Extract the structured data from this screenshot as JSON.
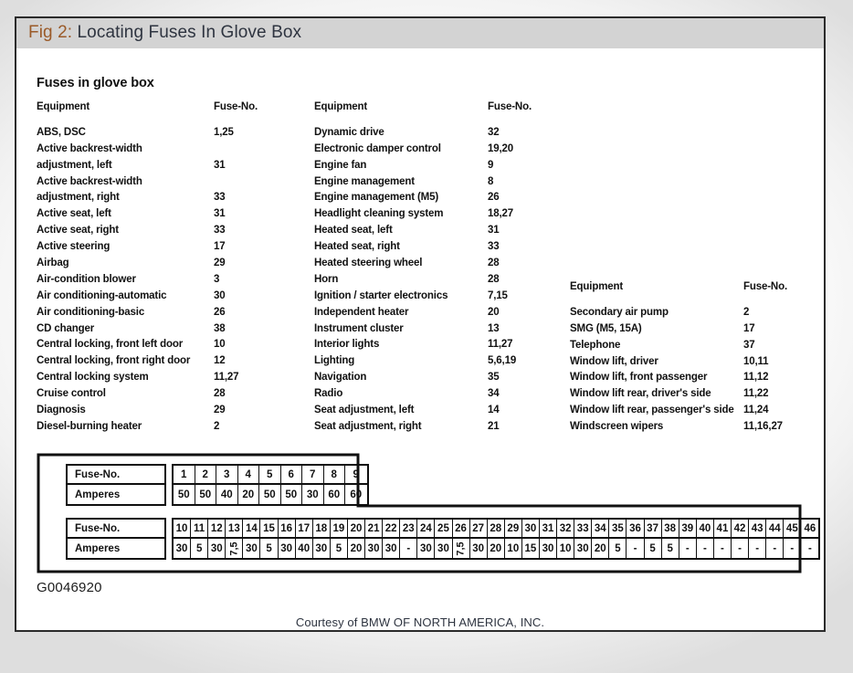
{
  "figure": {
    "title_prefix": "Fig 2:",
    "title_rest": " Locating Fuses In Glove Box",
    "heading": "Fuses in glove box",
    "graphic_id": "G0046920",
    "courtesy": "Courtesy of BMW OF NORTH AMERICA, INC.",
    "title_accent_color": "#9a5a28",
    "titlebar_color": "#d3d3d3"
  },
  "columns": {
    "header": {
      "equipment": "Equipment",
      "fuse_no": "Fuse-No."
    },
    "col1": [
      {
        "name": "ABS, DSC",
        "fuse": "1,25"
      },
      {
        "name": "Active backrest-width",
        "fuse": ""
      },
      {
        "name": "adjustment, left",
        "fuse": "31"
      },
      {
        "name": "Active backrest-width",
        "fuse": ""
      },
      {
        "name": "adjustment, right",
        "fuse": "33"
      },
      {
        "name": "Active seat, left",
        "fuse": "31"
      },
      {
        "name": "Active seat, right",
        "fuse": "33"
      },
      {
        "name": "Active steering",
        "fuse": "17"
      },
      {
        "name": "Airbag",
        "fuse": "29"
      },
      {
        "name": "Air-condition blower",
        "fuse": "3"
      },
      {
        "name": "Air conditioning-automatic",
        "fuse": "30"
      },
      {
        "name": "Air conditioning-basic",
        "fuse": "26"
      },
      {
        "name": "CD changer",
        "fuse": "38"
      },
      {
        "name": "Central locking, front left door",
        "fuse": "10"
      },
      {
        "name": "Central locking, front right door",
        "fuse": "12"
      },
      {
        "name": "Central locking system",
        "fuse": "11,27"
      },
      {
        "name": "Cruise control",
        "fuse": "28"
      },
      {
        "name": "Diagnosis",
        "fuse": "29"
      },
      {
        "name": "Diesel-burning heater",
        "fuse": "2"
      }
    ],
    "col2": [
      {
        "name": "Dynamic drive",
        "fuse": "32"
      },
      {
        "name": "Electronic damper control",
        "fuse": "19,20"
      },
      {
        "name": "Engine fan",
        "fuse": "9"
      },
      {
        "name": "Engine management",
        "fuse": "8"
      },
      {
        "name": "Engine management (M5)",
        "fuse": "26"
      },
      {
        "name": "Headlight cleaning system",
        "fuse": "18,27"
      },
      {
        "name": "Heated seat, left",
        "fuse": "31"
      },
      {
        "name": "Heated seat, right",
        "fuse": "33"
      },
      {
        "name": "Heated steering wheel",
        "fuse": "28"
      },
      {
        "name": "Horn",
        "fuse": "28"
      },
      {
        "name": "Ignition / starter electronics",
        "fuse": "7,15"
      },
      {
        "name": "Independent heater",
        "fuse": "20"
      },
      {
        "name": "Instrument cluster",
        "fuse": "13"
      },
      {
        "name": "Interior lights",
        "fuse": "11,27"
      },
      {
        "name": "Lighting",
        "fuse": "5,6,19"
      },
      {
        "name": "Navigation",
        "fuse": "35"
      },
      {
        "name": "Radio",
        "fuse": "34"
      },
      {
        "name": "Seat adjustment, left",
        "fuse": "14"
      },
      {
        "name": "Seat adjustment, right",
        "fuse": "21"
      }
    ],
    "col3": [
      {
        "name": "Secondary air pump",
        "fuse": "2"
      },
      {
        "name": "SMG (M5, 15A)",
        "fuse": "17"
      },
      {
        "name": "Telephone",
        "fuse": "37"
      },
      {
        "name": "Window lift, driver",
        "fuse": "10,11"
      },
      {
        "name": "Window lift, front passenger",
        "fuse": "11,12"
      },
      {
        "name": "Window lift rear, driver's side",
        "fuse": "11,22"
      },
      {
        "name": "Window lift rear, passenger's side",
        "fuse": "11,24"
      },
      {
        "name": "Windscreen wipers",
        "fuse": "11,16,27"
      }
    ]
  },
  "ampere_tables": {
    "row_labels": {
      "fuse_no": "Fuse-No.",
      "amperes": "Amperes"
    },
    "table_a": {
      "fuse_numbers": [
        "1",
        "2",
        "3",
        "4",
        "5",
        "6",
        "7",
        "8",
        "9"
      ],
      "amperes": [
        "50",
        "50",
        "40",
        "20",
        "50",
        "50",
        "30",
        "60",
        "60"
      ]
    },
    "table_b": {
      "fuse_numbers": [
        "10",
        "11",
        "12",
        "13",
        "14",
        "15",
        "16",
        "17",
        "18",
        "19",
        "20",
        "21",
        "22",
        "23",
        "24",
        "25",
        "26",
        "27",
        "28",
        "29",
        "30",
        "31",
        "32",
        "33",
        "34",
        "35",
        "36",
        "37",
        "38",
        "39",
        "40",
        "41",
        "42",
        "43",
        "44",
        "45",
        "46"
      ],
      "amperes": [
        "30",
        "5",
        "30",
        "7,5",
        "30",
        "5",
        "30",
        "40",
        "30",
        "5",
        "20",
        "30",
        "30",
        "-",
        "30",
        "30",
        "7,5",
        "30",
        "20",
        "10",
        "15",
        "30",
        "10",
        "30",
        "20",
        "5",
        "-",
        "5",
        "5",
        "-",
        "-",
        "-",
        "-",
        "-",
        "-",
        "-",
        "-"
      ]
    },
    "rotated_values": [
      "7,5"
    ]
  }
}
